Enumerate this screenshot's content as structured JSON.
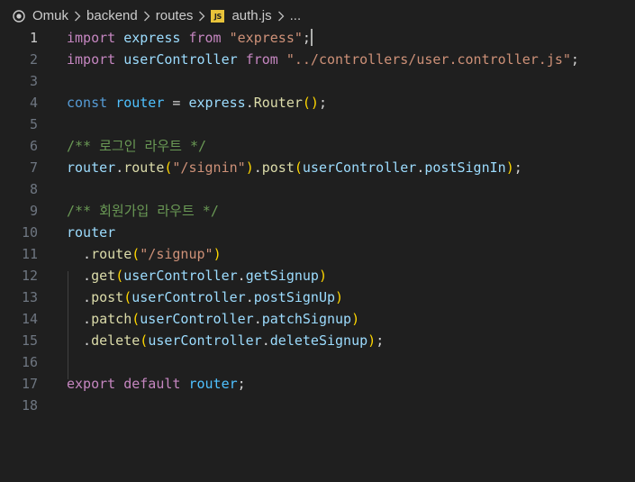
{
  "breadcrumb": {
    "items": [
      "Omuk",
      "backend",
      "routes",
      "auth.js",
      "..."
    ],
    "file_icon_text": "JS"
  },
  "editor": {
    "active_line": 1,
    "line_numbers": [
      "1",
      "2",
      "3",
      "4",
      "5",
      "6",
      "7",
      "8",
      "9",
      "10",
      "11",
      "12",
      "13",
      "14",
      "15",
      "16",
      "17",
      "18"
    ],
    "lines": [
      [
        {
          "t": "import",
          "c": "kw-ctrl"
        },
        {
          "t": " ",
          "c": "punc"
        },
        {
          "t": "express",
          "c": "var"
        },
        {
          "t": " ",
          "c": "punc"
        },
        {
          "t": "from",
          "c": "kw-ctrl"
        },
        {
          "t": " ",
          "c": "punc"
        },
        {
          "t": "\"express\"",
          "c": "str"
        },
        {
          "t": ";",
          "c": "punc"
        }
      ],
      [
        {
          "t": "import",
          "c": "kw-ctrl"
        },
        {
          "t": " ",
          "c": "punc"
        },
        {
          "t": "userController",
          "c": "var"
        },
        {
          "t": " ",
          "c": "punc"
        },
        {
          "t": "from",
          "c": "kw-ctrl"
        },
        {
          "t": " ",
          "c": "punc"
        },
        {
          "t": "\"../controllers/user.controller.js\"",
          "c": "str"
        },
        {
          "t": ";",
          "c": "punc"
        }
      ],
      [],
      [
        {
          "t": "const",
          "c": "kw"
        },
        {
          "t": " ",
          "c": "punc"
        },
        {
          "t": "router",
          "c": "const"
        },
        {
          "t": " = ",
          "c": "punc"
        },
        {
          "t": "express",
          "c": "var"
        },
        {
          "t": ".",
          "c": "punc"
        },
        {
          "t": "Router",
          "c": "fn"
        },
        {
          "t": "()",
          "c": "br1"
        },
        {
          "t": ";",
          "c": "punc"
        }
      ],
      [],
      [
        {
          "t": "/** 로그인 라우트 */",
          "c": "cmt"
        }
      ],
      [
        {
          "t": "router",
          "c": "var"
        },
        {
          "t": ".",
          "c": "punc"
        },
        {
          "t": "route",
          "c": "fn"
        },
        {
          "t": "(",
          "c": "br1"
        },
        {
          "t": "\"/signin\"",
          "c": "str"
        },
        {
          "t": ")",
          "c": "br1"
        },
        {
          "t": ".",
          "c": "punc"
        },
        {
          "t": "post",
          "c": "fn"
        },
        {
          "t": "(",
          "c": "br1"
        },
        {
          "t": "userController",
          "c": "var"
        },
        {
          "t": ".",
          "c": "punc"
        },
        {
          "t": "postSignIn",
          "c": "var"
        },
        {
          "t": ")",
          "c": "br1"
        },
        {
          "t": ";",
          "c": "punc"
        }
      ],
      [],
      [
        {
          "t": "/** 회원가입 라우트 */",
          "c": "cmt"
        }
      ],
      [
        {
          "t": "router",
          "c": "var"
        }
      ],
      [
        {
          "t": "  .",
          "c": "punc"
        },
        {
          "t": "route",
          "c": "fn"
        },
        {
          "t": "(",
          "c": "br1"
        },
        {
          "t": "\"/signup\"",
          "c": "str"
        },
        {
          "t": ")",
          "c": "br1"
        }
      ],
      [
        {
          "t": "  .",
          "c": "punc"
        },
        {
          "t": "get",
          "c": "fn"
        },
        {
          "t": "(",
          "c": "br1"
        },
        {
          "t": "userController",
          "c": "var"
        },
        {
          "t": ".",
          "c": "punc"
        },
        {
          "t": "getSignup",
          "c": "var"
        },
        {
          "t": ")",
          "c": "br1"
        }
      ],
      [
        {
          "t": "  .",
          "c": "punc"
        },
        {
          "t": "post",
          "c": "fn"
        },
        {
          "t": "(",
          "c": "br1"
        },
        {
          "t": "userController",
          "c": "var"
        },
        {
          "t": ".",
          "c": "punc"
        },
        {
          "t": "postSignUp",
          "c": "var"
        },
        {
          "t": ")",
          "c": "br1"
        }
      ],
      [
        {
          "t": "  .",
          "c": "punc"
        },
        {
          "t": "patch",
          "c": "fn"
        },
        {
          "t": "(",
          "c": "br1"
        },
        {
          "t": "userController",
          "c": "var"
        },
        {
          "t": ".",
          "c": "punc"
        },
        {
          "t": "patchSignup",
          "c": "var"
        },
        {
          "t": ")",
          "c": "br1"
        }
      ],
      [
        {
          "t": "  .",
          "c": "punc"
        },
        {
          "t": "delete",
          "c": "fn"
        },
        {
          "t": "(",
          "c": "br1"
        },
        {
          "t": "userController",
          "c": "var"
        },
        {
          "t": ".",
          "c": "punc"
        },
        {
          "t": "deleteSignup",
          "c": "var"
        },
        {
          "t": ")",
          "c": "br1"
        },
        {
          "t": ";",
          "c": "punc"
        }
      ],
      [],
      [
        {
          "t": "export",
          "c": "kw-ctrl"
        },
        {
          "t": " ",
          "c": "punc"
        },
        {
          "t": "default",
          "c": "kw-ctrl"
        },
        {
          "t": " ",
          "c": "punc"
        },
        {
          "t": "router",
          "c": "const"
        },
        {
          "t": ";",
          "c": "punc"
        }
      ],
      []
    ]
  },
  "colors": {
    "background": "#1f1f1f",
    "keyword_control": "#c586c0",
    "keyword": "#569cd6",
    "variable": "#9cdcfe",
    "constant": "#4fc1ff",
    "string": "#ce9178",
    "function": "#dcdcaa",
    "comment": "#6a9955",
    "bracket": "#ffd700",
    "line_number": "#6e7681"
  }
}
